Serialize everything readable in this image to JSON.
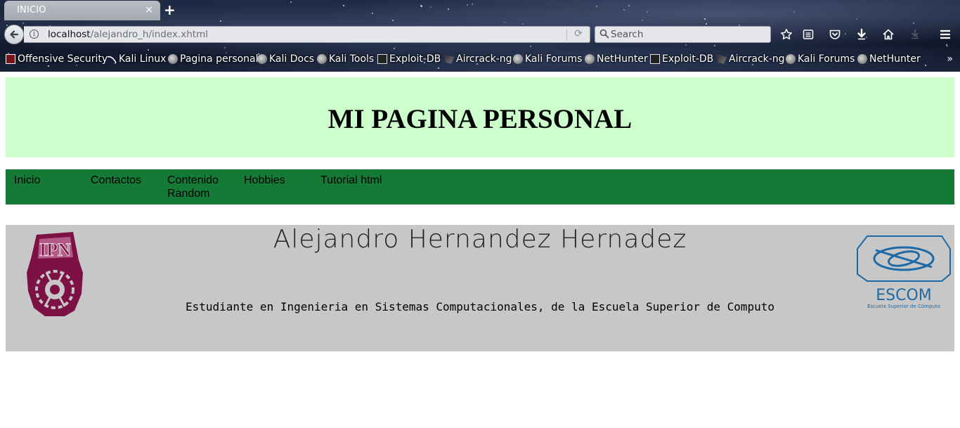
{
  "browser": {
    "tab_title": "INICIO",
    "tab_close": "×",
    "new_tab": "+",
    "url_host": "localhost",
    "url_path": "/alejandro_h/index.xhtml",
    "search_placeholder": "Search",
    "bookmarks": [
      {
        "label": "Offensive Security",
        "icon": "offensive-security-icon"
      },
      {
        "label": "Kali Linux",
        "icon": "kali-linux-icon"
      },
      {
        "label": "Pagina personal",
        "icon": "globe-icon"
      },
      {
        "label": "Kali Docs",
        "icon": "globe-icon"
      },
      {
        "label": "Kali Tools",
        "icon": "globe-icon"
      },
      {
        "label": "Exploit-DB",
        "icon": "exploit-db-icon"
      },
      {
        "label": "Aircrack-ng",
        "icon": "aircrack-icon"
      },
      {
        "label": "Kali Forums",
        "icon": "globe-icon"
      },
      {
        "label": "NetHunter",
        "icon": "globe-icon"
      },
      {
        "label": "Exploit-DB",
        "icon": "exploit-db-icon"
      },
      {
        "label": "Aircrack-ng",
        "icon": "aircrack-icon"
      },
      {
        "label": "Kali Forums",
        "icon": "globe-icon"
      },
      {
        "label": "NetHunter",
        "icon": "globe-icon"
      }
    ],
    "bookmarks_more": "»"
  },
  "page": {
    "title": "MI PAGINA PERSONAL",
    "menu": [
      "Inicio",
      "Contactos",
      "Contenido Random",
      "Hobbies",
      "Tutorial html"
    ],
    "profile": {
      "name": "Alejandro Hernandez Hernadez",
      "description": "Estudiante en Ingenieria en Sistemas Computacionales, de la Escuela Superior de Computo",
      "escom_logo_text": "ESCOM",
      "escom_logo_subtext": "Escuela Superior de Cómputo"
    }
  },
  "colors": {
    "header_bg": "#ccffcc",
    "menu_bg": "#157a36",
    "profile_bg": "#c7c7c7",
    "ipn_logo": "#7d1146",
    "escom_logo": "#1f6aa5"
  }
}
